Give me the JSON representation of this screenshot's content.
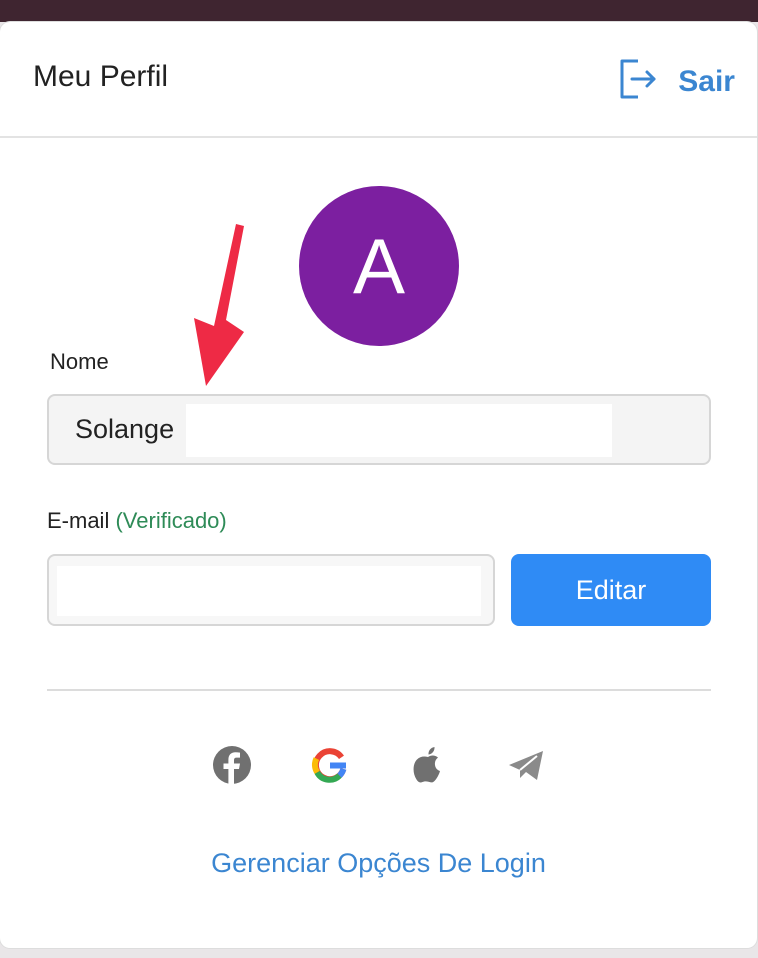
{
  "header": {
    "title": "Meu Perfil",
    "logout_label": "Sair",
    "logout_icon": "logout-icon"
  },
  "avatar": {
    "initial": "A",
    "color": "#7c1fa0"
  },
  "form": {
    "name_label": "Nome",
    "name_value": "Solange",
    "email_label": "E-mail",
    "email_status": "(Verificado)",
    "email_value": "",
    "edit_button": "Editar"
  },
  "social_logins": [
    {
      "name": "facebook-icon"
    },
    {
      "name": "google-icon"
    },
    {
      "name": "apple-icon"
    },
    {
      "name": "telegram-icon"
    }
  ],
  "manage_login_link": "Gerenciar Opções De Login",
  "colors": {
    "accent": "#3b86d1",
    "button": "#2f8bf5",
    "verified": "#2e8b57",
    "annotation_arrow": "#ee2a45"
  }
}
